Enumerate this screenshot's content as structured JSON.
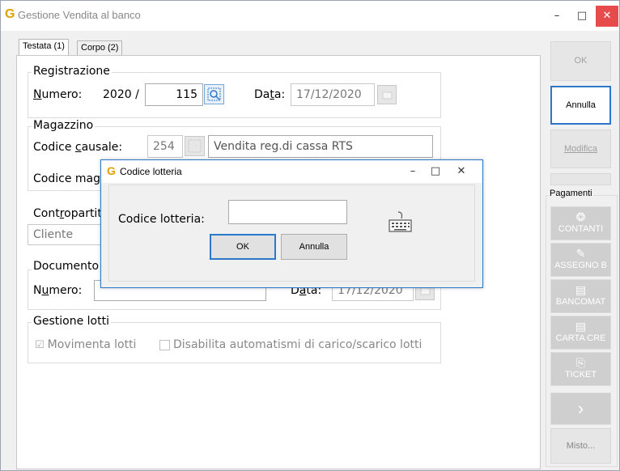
{
  "window": {
    "logo": "G",
    "title": "Gestione Vendita al banco",
    "minimize": "–",
    "maximize": "□",
    "close": "✕"
  },
  "tabs": [
    {
      "label": "Testata (1)"
    },
    {
      "label": "Corpo (2)"
    }
  ],
  "registrazione": {
    "title": "Registrazione",
    "numero_label": "umero:",
    "numero_accel": "N",
    "anno": "2020 /",
    "numero": "115",
    "data_label_pre": "Da",
    "data_label_accel": "t",
    "data_label_post": "a:",
    "data": "17/12/2020"
  },
  "magazzino": {
    "title": "Magazzino",
    "causale_label_pre": "Codice ",
    "causale_label_accel": "c",
    "causale_label_post": "ausale:",
    "causale_code": "254",
    "causale_desc": "Vendita  reg.di cassa RTS",
    "codice_mag_label": "Codice mag"
  },
  "contropartita": {
    "title_pre": "Cont",
    "title_accel": "r",
    "title_post": "opartita",
    "value": "Cliente"
  },
  "documento": {
    "title": "Documento",
    "numero_label_pre": "N",
    "numero_label_accel": "u",
    "numero_label_post": "mero:",
    "data_label_pre": "D",
    "data_label_accel": "a",
    "data_label_post": "ta:",
    "data": "17/12/2020"
  },
  "lotti": {
    "title": "Gestione lotti",
    "movimenta": "Movimenta lotti",
    "disabilita": "Disabilita automatismi di carico/scarico lotti"
  },
  "right_panel": {
    "ok": "OK",
    "annulla": "Annulla",
    "modifica": "Modifica",
    "pagamenti": "Pagamenti",
    "contanti": "CONTANTI",
    "assegno": "ASSEGNO B",
    "bancomat": "BANCOMAT",
    "carta": "CARTA CRE",
    "ticket": "TICKET",
    "misto": "Misto..."
  },
  "dialog": {
    "logo": "G",
    "title": "Codice lotteria",
    "minimize": "–",
    "maximize": "□",
    "close": "✕",
    "label": "Codice lotteria:",
    "value": "",
    "ok": "OK",
    "annulla": "Annulla"
  }
}
